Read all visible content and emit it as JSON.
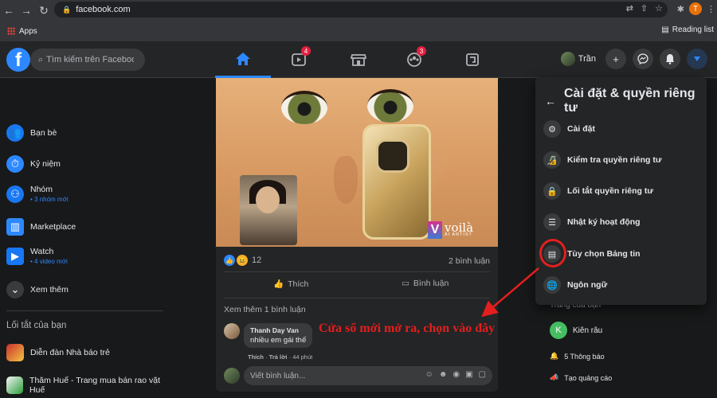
{
  "browser": {
    "url": "facebook.com",
    "bookmarks_apps": "Apps",
    "reading_list": "Reading list",
    "profile_initial": "T"
  },
  "fb": {
    "search_placeholder": "Tìm kiếm trên Facebook",
    "badges": {
      "watch": "4",
      "groups": "3"
    },
    "profile_name": "Trần"
  },
  "left_nav": {
    "items": [
      {
        "label": "Bạn bè",
        "sub": ""
      },
      {
        "label": "Kỷ niệm",
        "sub": ""
      },
      {
        "label": "Nhóm",
        "sub": "• 3 nhóm mới"
      },
      {
        "label": "Marketplace",
        "sub": ""
      },
      {
        "label": "Watch",
        "sub": "• 4 video mới"
      },
      {
        "label": "Xem thêm",
        "sub": ""
      }
    ],
    "shortcuts_heading": "Lối tắt của bạn",
    "shortcuts": [
      {
        "label": "Diễn đàn Nhà báo trẻ"
      },
      {
        "label": "Thăm Huế - Trang mua bán rao vặt Huế"
      }
    ]
  },
  "post": {
    "watermark": "voilà",
    "watermark_sub": "AI ARTIST",
    "reaction_count": "12",
    "comment_count": "2 bình luận",
    "like_label": "Thích",
    "comment_label": "Bình luận",
    "more_comments": "Xem thêm 1 bình luận",
    "comment": {
      "author": "Thanh Day Van",
      "text": "nhiều em gái thế",
      "like": "Thích",
      "reply": "Trả lời",
      "time": "44 phút"
    },
    "write_placeholder": "Viết bình luận..."
  },
  "menu": {
    "title": "Cài đặt & quyền riêng tư",
    "items": [
      {
        "label": "Cài đặt",
        "icon": "gear-icon"
      },
      {
        "label": "Kiểm tra quyền riêng tư",
        "icon": "lock-plus-icon"
      },
      {
        "label": "Lối tắt quyền riêng tư",
        "icon": "lock-icon"
      },
      {
        "label": "Nhật ký hoạt động",
        "icon": "list-icon"
      },
      {
        "label": "Tùy chọn Bảng tin",
        "icon": "feed-icon"
      },
      {
        "label": "Ngôn ngữ",
        "icon": "globe-icon"
      }
    ]
  },
  "right_col": {
    "page_heading": "Trang của bạn",
    "page_name": "Kiên râu",
    "page_initial": "K",
    "notifications": "5 Thông báo",
    "create_ad": "Tạo quảng cáo"
  },
  "annotation": {
    "text": "Cửa sổ mới mở ra, chọn vào đây",
    "color": "#e41e1e"
  }
}
